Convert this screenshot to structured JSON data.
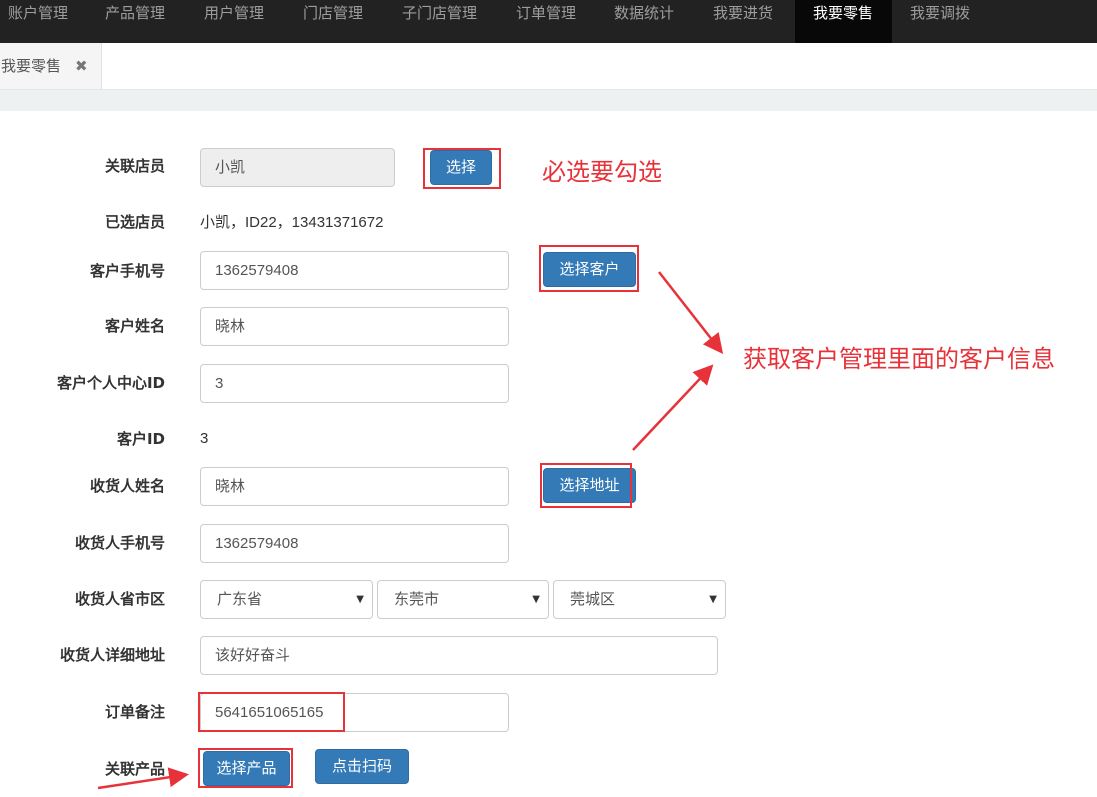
{
  "nav": {
    "items": [
      {
        "label": "账户管理"
      },
      {
        "label": "产品管理"
      },
      {
        "label": "用户管理"
      },
      {
        "label": "门店管理"
      },
      {
        "label": "子门店管理"
      },
      {
        "label": "订单管理"
      },
      {
        "label": "数据统计"
      },
      {
        "label": "我要进货"
      },
      {
        "label": "我要零售",
        "active": true
      },
      {
        "label": "我要调拨"
      }
    ]
  },
  "tabs": {
    "active_label": "我要零售",
    "close_glyph": "✖"
  },
  "form": {
    "staff": {
      "label": "关联店员",
      "value": "小凯",
      "button": "选择"
    },
    "selected_staff": {
      "label": "已选店员",
      "value": "小凯，ID22，13431371672"
    },
    "customer_phone": {
      "label": "客户手机号",
      "value": "1362579408",
      "button": "选择客户"
    },
    "customer_name": {
      "label": "客户姓名",
      "value": "晓林"
    },
    "customer_center_id": {
      "label": "客户个人中心ID",
      "value": "3"
    },
    "customer_id": {
      "label": "客户ID",
      "value": "3"
    },
    "receiver_name": {
      "label": "收货人姓名",
      "value": "晓林",
      "button": "选择地址"
    },
    "receiver_phone": {
      "label": "收货人手机号",
      "value": "1362579408"
    },
    "receiver_region": {
      "label": "收货人省市区",
      "province": "广东省",
      "city": "东莞市",
      "district": "莞城区"
    },
    "receiver_address": {
      "label": "收货人详细地址",
      "value": "该好好奋斗"
    },
    "order_note": {
      "label": "订单备注",
      "value": "5641651065165"
    },
    "products": {
      "label": "关联产品",
      "select_button": "选择产品",
      "scan_button": "点击扫码"
    }
  },
  "annotations": {
    "must_select": "必选要勾选",
    "customer_info": "获取客户管理里面的客户信息"
  },
  "colors": {
    "nav_bg": "#222222",
    "primary": "#337ab7",
    "annotation_red": "#e8323a"
  }
}
